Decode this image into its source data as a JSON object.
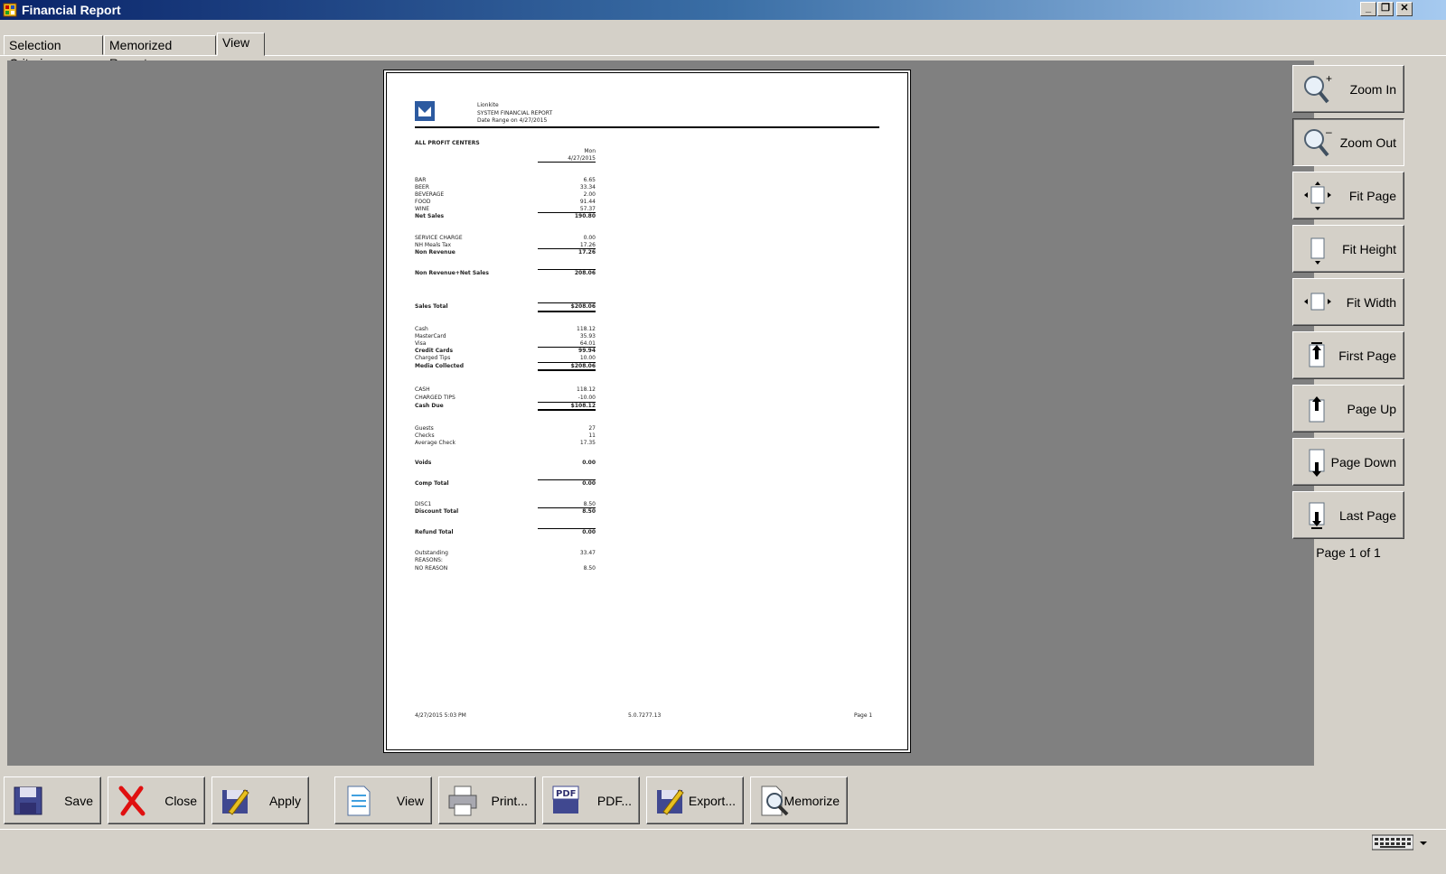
{
  "window": {
    "title": "Financial Report"
  },
  "tabs": [
    {
      "label": "Selection Criteria"
    },
    {
      "label": "Memorized Reports"
    },
    {
      "label": "View"
    }
  ],
  "report": {
    "company": "Lionkite",
    "title": "SYSTEM FINANCIAL REPORT",
    "date_range": "Date Range on 4/27/2015",
    "section": "ALL PROFIT CENTERS",
    "col_day": "Mon",
    "col_date": "4/27/2015",
    "rows": [
      {
        "label": "BAR",
        "value": "6.65"
      },
      {
        "label": "BEER",
        "value": "33.34"
      },
      {
        "label": "BEVERAGE",
        "value": "2.00"
      },
      {
        "label": "FOOD",
        "value": "91.44"
      },
      {
        "label": "WINE",
        "value": "57.37"
      },
      {
        "label": "Net Sales",
        "value": "190.80"
      },
      {
        "label": "SERVICE CHARGE",
        "value": "0.00"
      },
      {
        "label": "NH Meals Tax",
        "value": "17.26"
      },
      {
        "label": "Non Revenue",
        "value": "17.26"
      },
      {
        "label": "Non Revenue+Net Sales",
        "value": "208.06"
      },
      {
        "label": "Sales Total",
        "value": "$208.06"
      },
      {
        "label": "Cash",
        "value": "118.12"
      },
      {
        "label": "MasterCard",
        "value": "35.93"
      },
      {
        "label": "Visa",
        "value": "64.01"
      },
      {
        "label": "Credit Cards",
        "value": "99.94"
      },
      {
        "label": "Charged Tips",
        "value": "10.00"
      },
      {
        "label": "Media Collected",
        "value": "$208.06"
      },
      {
        "label": "CASH",
        "value": "118.12"
      },
      {
        "label": "CHARGED TIPS",
        "value": "-10.00"
      },
      {
        "label": "Cash Due",
        "value": "$108.12"
      },
      {
        "label": "Guests",
        "value": "27"
      },
      {
        "label": "Checks",
        "value": "11"
      },
      {
        "label": "Average Check",
        "value": "17.35"
      },
      {
        "label": "Voids",
        "value": "0.00"
      },
      {
        "label": "Comp Total",
        "value": "0.00"
      },
      {
        "label": "DISC1",
        "value": "8.50"
      },
      {
        "label": "Discount Total",
        "value": "8.50"
      },
      {
        "label": "Refund Total",
        "value": "0.00"
      },
      {
        "label": "Outstanding",
        "value": "33.47"
      },
      {
        "label": "REASONS:",
        "value": ""
      },
      {
        "label": "NO REASON",
        "value": "8.50"
      }
    ],
    "footer_datetime": "4/27/2015 5:03 PM",
    "footer_version": "5.0.7277.13",
    "footer_page": "Page 1"
  },
  "side_buttons": [
    {
      "label": "Zoom In",
      "icon": "zoom-in-icon"
    },
    {
      "label": "Zoom Out",
      "icon": "zoom-out-icon"
    },
    {
      "label": "Fit Page",
      "icon": "fit-page-icon"
    },
    {
      "label": "Fit Height",
      "icon": "fit-height-icon"
    },
    {
      "label": "Fit Width",
      "icon": "fit-width-icon"
    },
    {
      "label": "First Page",
      "icon": "first-page-icon"
    },
    {
      "label": "Page Up",
      "icon": "page-up-icon"
    },
    {
      "label": "Page Down",
      "icon": "page-down-icon"
    },
    {
      "label": "Last Page",
      "icon": "last-page-icon"
    }
  ],
  "page_indicator": "Page 1 of 1",
  "bottom_buttons": [
    {
      "label": "Save",
      "icon": "floppy-disk-icon"
    },
    {
      "label": "Close",
      "icon": "red-x-icon"
    },
    {
      "label": "Apply",
      "icon": "apply-pencil-icon"
    },
    {
      "label": "View",
      "icon": "document-view-icon"
    },
    {
      "label": "Print...",
      "icon": "printer-icon"
    },
    {
      "label": "PDF...",
      "icon": "pdf-icon"
    },
    {
      "label": "Export...",
      "icon": "export-icon"
    },
    {
      "label": "Memorize",
      "icon": "magnifier-document-icon"
    }
  ],
  "colors": {
    "preview_bg": "#808080",
    "window_bg": "#d4d0c8",
    "title_start": "#0a246a",
    "title_end": "#a6caf0"
  }
}
